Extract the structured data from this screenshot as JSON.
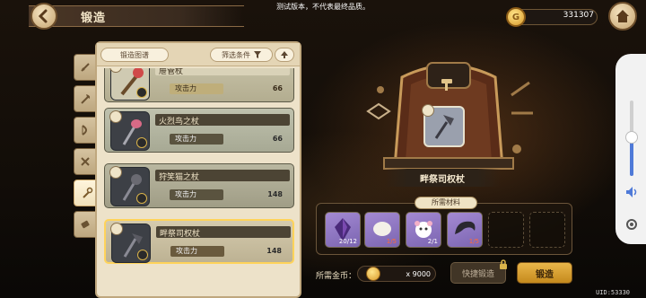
{
  "notice": "测试版本，不代表最终品质。",
  "header": {
    "title": "锻造",
    "gold": "331307"
  },
  "panel": {
    "atlas_label": "锻造图谱",
    "filter_label": "筛选条件",
    "items": [
      {
        "name": "屉管杖",
        "stat_label": "攻击力",
        "stat_value": "66"
      },
      {
        "name": "火烈鸟之杖",
        "stat_label": "攻击力",
        "stat_value": "66"
      },
      {
        "name": "狩笑猫之杖",
        "stat_label": "攻击力",
        "stat_value": "148"
      },
      {
        "name": "畔祭司权杖",
        "stat_label": "攻击力",
        "stat_value": "148"
      }
    ]
  },
  "forge": {
    "item_title": "畔祭司权杖",
    "materials_header": "所需材料",
    "materials": [
      {
        "icon": "purple-crystal-icon",
        "count": "20/12"
      },
      {
        "icon": "egg-icon",
        "count": "1/5"
      },
      {
        "icon": "white-creature-icon",
        "count": "2/1"
      },
      {
        "icon": "dark-horn-icon",
        "count": "1/5"
      }
    ],
    "cost_label": "所需金币：",
    "cost_value": "x 9000",
    "quick_label": "快捷锻造",
    "forge_label": "锻造"
  },
  "footer": {
    "uid": "UID:53330"
  },
  "colors": {
    "accent_gold": "#e9b64a",
    "selected_border": "#ffd35a",
    "shortage_red": "#ff6a3a"
  }
}
